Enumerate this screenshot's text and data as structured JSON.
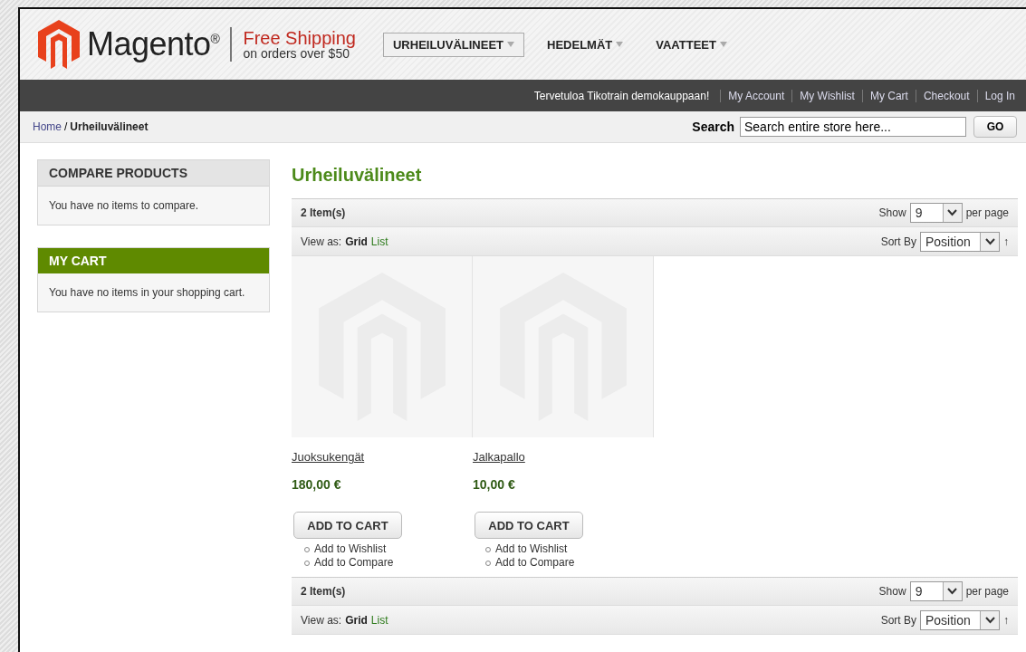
{
  "header": {
    "logo_text": "Magento",
    "logo_mark": "®",
    "promo_title": "Free Shipping",
    "promo_subtitle": "on orders over $50",
    "nav": [
      {
        "label": "URHEILUVÄLINEET",
        "selected": true
      },
      {
        "label": "HEDELMÄT",
        "selected": false
      },
      {
        "label": "VAATTEET",
        "selected": false
      }
    ]
  },
  "top_bar": {
    "welcome": "Tervetuloa Tikotrain demokauppaan!",
    "links": [
      "My Account",
      "My Wishlist",
      "My Cart",
      "Checkout",
      "Log In"
    ]
  },
  "breadcrumb": {
    "home": "Home",
    "separator": "/",
    "current": "Urheiluvälineet"
  },
  "search": {
    "label": "Search",
    "value": "Search entire store here...",
    "button": "GO"
  },
  "sidebar": [
    {
      "title": "COMPARE PRODUCTS",
      "kind": "plain",
      "text": "You have no items to compare."
    },
    {
      "title": "MY CART",
      "kind": "cart",
      "text": "You have no items in your shopping cart."
    }
  ],
  "category_title": "Urheiluvälineet",
  "toolbars": [
    {
      "count": "2 Item(s)",
      "show_label": "Show",
      "show_value": "9",
      "per_page": "per page",
      "view_label": "View as:",
      "view_modes": [
        {
          "label": "Grid",
          "selected": true
        },
        {
          "label": "List",
          "selected": false
        }
      ],
      "sort_label": "Sort By",
      "sort_value": "Position",
      "sort_arrow": "↑"
    },
    {
      "count": "2 Item(s)",
      "show_label": "Show",
      "show_value": "9",
      "per_page": "per page",
      "view_label": "View as:",
      "view_modes": [
        {
          "label": "Grid",
          "selected": true
        },
        {
          "label": "List",
          "selected": false
        }
      ],
      "sort_label": "Sort By",
      "sort_value": "Position",
      "sort_arrow": "↑"
    }
  ],
  "products": [
    {
      "name": "Juoksukengät",
      "price": "180,00 €",
      "button": "ADD TO CART",
      "links": [
        "Add to Wishlist",
        "Add to Compare"
      ]
    },
    {
      "name": "Jalkapallo",
      "price": "10,00 €",
      "button": "ADD TO CART",
      "links": [
        "Add to Wishlist",
        "Add to Compare"
      ]
    }
  ]
}
